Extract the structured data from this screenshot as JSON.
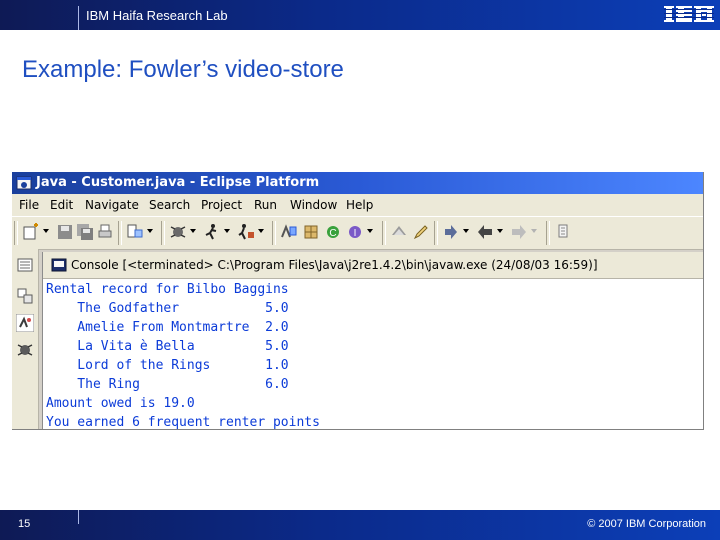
{
  "header": {
    "lab_name": "IBM Haifa Research Lab",
    "logo": "IBM"
  },
  "slide": {
    "title": "Example: Fowler’s video-store"
  },
  "window": {
    "title": "Java - Customer.java - Eclipse Platform",
    "menu": [
      "File",
      "Edit",
      "Navigate",
      "Search",
      "Project",
      "Run",
      "Window",
      "Help"
    ]
  },
  "console": {
    "tab_label": "Console [<terminated> C:\\Program Files\\Java\\j2re1.4.2\\bin\\javaw.exe (24/08/03 16:59)]",
    "lines": [
      "Rental record for Bilbo Baggins",
      "    The Godfather           5.0",
      "    Amelie From Montmartre  2.0",
      "    La Vita è Bella         5.0",
      "    Lord of the Rings       1.0",
      "    The Ring                6.0",
      "Amount owed is 19.0",
      "You earned 6 frequent renter points"
    ],
    "text_color": "#0b3bd8"
  },
  "footer": {
    "page_number": "15",
    "copyright": "© 2007 IBM Corporation"
  }
}
